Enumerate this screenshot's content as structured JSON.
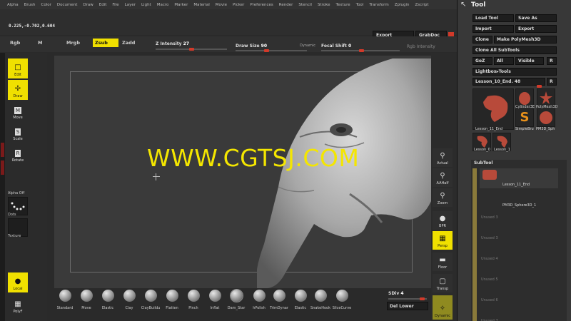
{
  "menu": [
    "Alpha",
    "Brush",
    "Color",
    "Document",
    "Draw",
    "Edit",
    "File",
    "Layer",
    "Light",
    "Macro",
    "Marker",
    "Material",
    "Movie",
    "Picker",
    "Preferences",
    "Render",
    "Stencil",
    "Stroke",
    "Texture",
    "Tool",
    "Transform",
    "Zplugin",
    "Zscript"
  ],
  "coords": "0.225,-0.702,0.604",
  "top_buttons": {
    "export": "Export",
    "grabdoc": "GrabDoc"
  },
  "modes": {
    "rgb": "Rgb",
    "m": "M",
    "mrgb": "Mrgb",
    "zsub": "Zsub",
    "zadd": "Zadd"
  },
  "sliders": {
    "z_intensity": {
      "label": "Z Intensity",
      "value": "27"
    },
    "draw_size": {
      "label": "Draw Size",
      "value": "90"
    },
    "dynamic": "Dynamic",
    "focal_shift": {
      "label": "Focal Shift",
      "value": "0"
    },
    "rgb_intensity": "Rgb Intensity"
  },
  "left_tools": {
    "edit": "Edit",
    "draw": "Draw",
    "move": "Move",
    "scale": "Scale",
    "rotate": "Rotate",
    "alpha": "Alpha Off",
    "dots": "Dots",
    "texture": "Texture",
    "local": "Local",
    "polyf": "PolyF"
  },
  "watermark": "WWW.CGTSJ.COM",
  "right_tools": {
    "actual": "Actual",
    "aahalf": "AAHalf",
    "zoom": "Zoom",
    "bpr": "BPR",
    "persp": "Persp",
    "floor": "Floor",
    "transp": "Transp",
    "dynamic": "Dynamic"
  },
  "brushes": [
    "Standard",
    "Move",
    "Elastic",
    "Clay",
    "ClayBuildu",
    "Flatten",
    "Pinch",
    "Inflat",
    "Dam_Star",
    "hPolish",
    "TrimDynar",
    "Elastic",
    "SnakeHook",
    "SliceCurve"
  ],
  "sdiv": {
    "label": "SDiv",
    "value": "4"
  },
  "del_lower": "Del Lower",
  "tool_panel": {
    "title": "Tool",
    "load_tool": "Load Tool",
    "save_as": "Save As",
    "import": "Import",
    "export": "Export",
    "clone": "Clone",
    "make_polymesh": "Make PolyMesh3D",
    "clone_all": "Clone All SubTools",
    "goz": "GoZ",
    "all": "All",
    "visible": "Visible",
    "r": "R",
    "lightbox_tools": "Lightbox▸Tools",
    "current_tool": "Lesson_10_End. 48",
    "count": "2",
    "thumbs": [
      "Lesson_11_End",
      "Cylinder3E",
      "PolyMesh3D",
      "SimpleBru",
      "PM3D_Sph",
      "Lesson_0",
      "Lesson_1"
    ],
    "subtool_head": "SubTool",
    "subtools": [
      "Lesson_11_End",
      "PM3D_Sphere3D_1",
      "Unused 3",
      "Unused 3",
      "Unused 4",
      "Unused 5",
      "Unused 6",
      "Unused 7"
    ]
  },
  "colors": {
    "accent": "#f0e000",
    "slider_knob": "#d23a2a",
    "watermark": "#f4e600"
  }
}
